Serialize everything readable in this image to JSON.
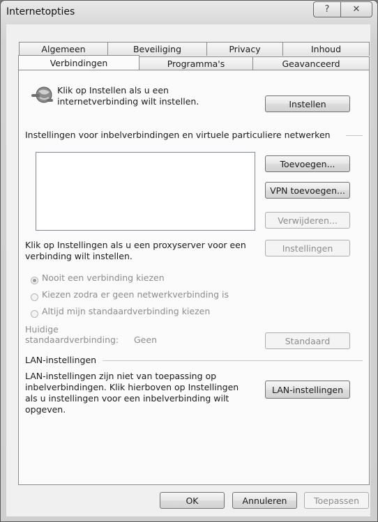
{
  "window": {
    "title": "Internetopties",
    "help_glyph": "?",
    "close_glyph": "✕"
  },
  "tabs_row1": [
    "Algemeen",
    "Beveiliging",
    "Privacy",
    "Inhoud"
  ],
  "tabs_row2": [
    "Verbindingen",
    "Programma's",
    "Geavanceerd"
  ],
  "active_tab": "Verbindingen",
  "setup": {
    "icon": "globe-network-icon",
    "text_line1": "Klik op Instellen als u een",
    "text_line2": "internetverbinding wilt instellen.",
    "button": "Instellen"
  },
  "dialup": {
    "heading": "Instellingen voor inbelverbindingen en virtuele particuliere netwerken",
    "add_button": "Toevoegen...",
    "add_vpn_button": "VPN toevoegen...",
    "remove_button": "Verwijderen...",
    "proxy_text_line1": "Klik op Instellingen als u een proxyserver voor een",
    "proxy_text_line2": "verbinding wilt instellen.",
    "settings_button": "Instellingen",
    "radio_options": [
      "Nooit een verbinding kiezen",
      "Kiezen zodra er geen netwerkverbinding is",
      "Altijd mijn standaardverbinding kiezen"
    ],
    "selected_option": "Nooit een verbinding kiezen",
    "current_default_label_line1": "Huidige",
    "current_default_label_line2": "standaardverbinding:",
    "current_default_value": "Geen",
    "default_button": "Standaard"
  },
  "lan": {
    "heading": "LAN-instellingen",
    "text_line1": "LAN-instellingen zijn niet van toepassing op",
    "text_line2": "inbelverbindingen. Klik hierboven op Instellingen",
    "text_line3": "als u instellingen voor een inbelverbinding wilt",
    "text_line4": "opgeven.",
    "button": "LAN-instellingen"
  },
  "footer": {
    "ok": "OK",
    "cancel": "Annuleren",
    "apply": "Toepassen"
  }
}
